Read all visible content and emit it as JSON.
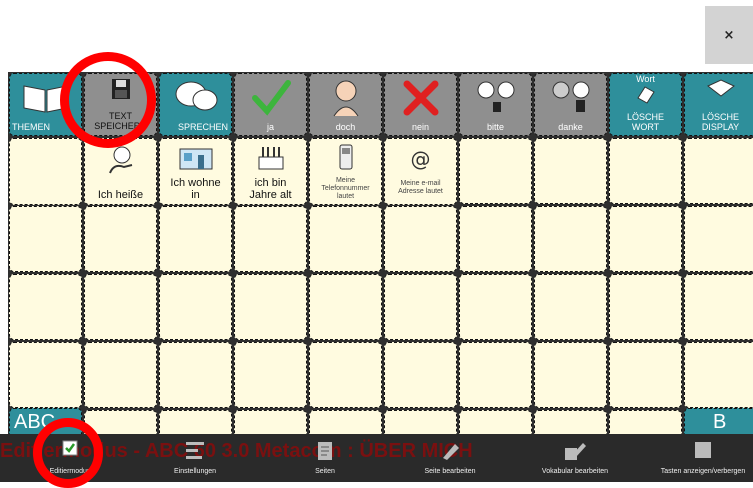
{
  "window": {
    "close_label": "×"
  },
  "top_row": [
    {
      "id": "themen",
      "label": "THEMEN",
      "icon": "book-icon",
      "color": "#2e8f9b"
    },
    {
      "id": "text-speichern",
      "label1": "TEXT",
      "label2": "SPEICHERN",
      "icon": "floppy-disk-icon",
      "color": "#8f8f8f"
    },
    {
      "id": "sprechen",
      "label": "SPRECHEN",
      "icon": "speech-bubbles-icon",
      "color": "#2e8f9b"
    },
    {
      "id": "ja",
      "label": "ja",
      "icon": "check-mark-icon",
      "color": "#8f8f8f"
    },
    {
      "id": "doch",
      "label": "doch",
      "icon": "person-icon",
      "color": "#8f8f8f"
    },
    {
      "id": "nein",
      "label": "nein",
      "icon": "red-x-icon",
      "color": "#8f8f8f"
    },
    {
      "id": "bitte",
      "label": "bitte",
      "icon": "people-giving-icon",
      "color": "#8f8f8f"
    },
    {
      "id": "danke",
      "label": "danke",
      "icon": "people-thanks-icon",
      "color": "#8f8f8f"
    },
    {
      "id": "loesche-wort",
      "label1": "LÖSCHE",
      "label2": "WORT",
      "top": "Wort",
      "icon": "eraser-hand-icon",
      "color": "#2e8f9b"
    },
    {
      "id": "loesche-display",
      "label1": "LÖSCHE",
      "label2": "DISPLAY",
      "icon": "eraser-icon",
      "color": "#2e8f9b"
    }
  ],
  "phrase_row": [
    {
      "label1": "Ich heiße",
      "label2": "",
      "icon": "person-name-icon",
      "size": "big"
    },
    {
      "label1": "Ich wohne",
      "label2": "in",
      "icon": "house-icon",
      "size": "big"
    },
    {
      "label1": "ich bin",
      "label2": "Jahre alt",
      "icon": "birthday-cake-icon",
      "size": "big"
    },
    {
      "label1": "Meine",
      "label2": "Telefonnummer",
      "label3": "lautet",
      "icon": "phone-icon",
      "size": "tiny"
    },
    {
      "label1": "Meine e-mail",
      "label2": "Adresse lautet",
      "icon": "at-sign-icon",
      "size": "tiny"
    }
  ],
  "status_bar": {
    "text": "Editiermodus - ABC 60 3.0 Metacom : ÜBER MICH"
  },
  "bottom_partial": {
    "left": "ABC",
    "right": "B"
  },
  "toolbar": {
    "items": [
      {
        "label": "Editiermodus",
        "icon": "checkbox-icon"
      },
      {
        "label": "Einstellungen",
        "icon": "sliders-icon"
      },
      {
        "label": "Seiten",
        "icon": "pages-icon"
      },
      {
        "label": "Seite bearbeiten",
        "icon": "pencil-icon"
      },
      {
        "label": "Vokabular bearbeiten",
        "icon": "edit-vocab-icon"
      },
      {
        "label": "Tasten anzeigen/verbergen",
        "icon": "keys-toggle-icon"
      }
    ]
  },
  "colors": {
    "teal": "#2e8f9b",
    "grey": "#8f8f8f",
    "cell": "#fffbe0",
    "highlight": "#ff0000"
  }
}
